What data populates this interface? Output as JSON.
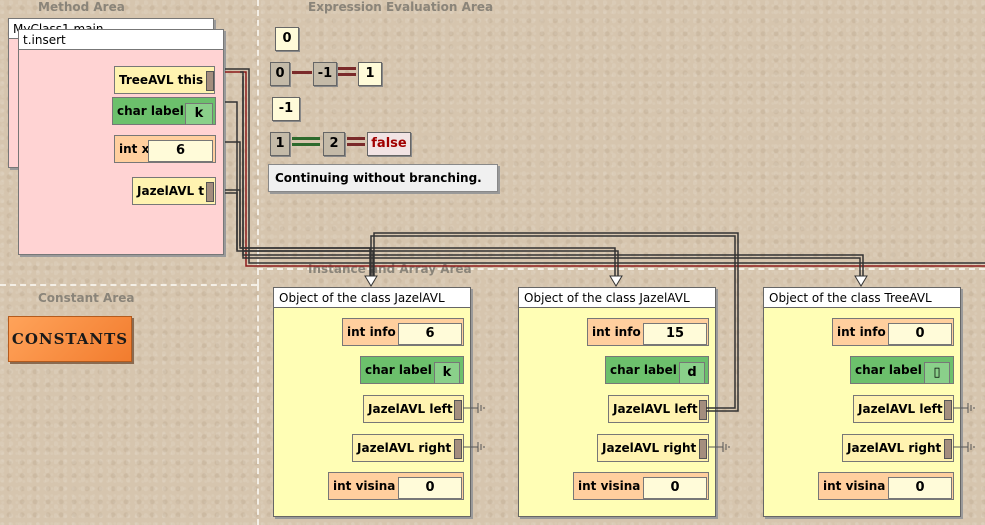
{
  "areas": {
    "method": "Method Area",
    "expression": "Expression Evaluation Area",
    "instance": "Instance and Array Area",
    "constant": "Constant Area"
  },
  "method_area": {
    "back_frame_title": "MyClass1.main",
    "frame_title": "t.insert",
    "vars": [
      {
        "type": "TreeAVL this",
        "value": ""
      },
      {
        "type": "char label",
        "value": "k"
      },
      {
        "type": "int x",
        "value": "6"
      },
      {
        "type": "JazelAVL t",
        "value": ""
      }
    ]
  },
  "expression_area": {
    "row1": "0",
    "row2": {
      "left": "0",
      "mid": "-1",
      "right": "1"
    },
    "row3": "-1",
    "row4": {
      "left": "1",
      "mid": "2",
      "result": "false"
    },
    "message": "Continuing without branching."
  },
  "constants_button": "CONSTANTS",
  "objects": [
    {
      "title": "Object of the class JazelAVL",
      "fields": [
        {
          "type": "int info",
          "value": "6"
        },
        {
          "type": "char label",
          "value": "k"
        },
        {
          "type": "JazelAVL left",
          "value": ""
        },
        {
          "type": "JazelAVL right",
          "value": ""
        },
        {
          "type": "int visina",
          "value": "0"
        }
      ]
    },
    {
      "title": "Object of the class JazelAVL",
      "fields": [
        {
          "type": "int info",
          "value": "15"
        },
        {
          "type": "char label",
          "value": "d"
        },
        {
          "type": "JazelAVL left",
          "value": ""
        },
        {
          "type": "JazelAVL right",
          "value": ""
        },
        {
          "type": "int visina",
          "value": "0"
        }
      ]
    },
    {
      "title": "Object of the class TreeAVL",
      "fields": [
        {
          "type": "int info",
          "value": "0"
        },
        {
          "type": "char label",
          "value": "▯"
        },
        {
          "type": "JazelAVL left",
          "value": ""
        },
        {
          "type": "JazelAVL right",
          "value": ""
        },
        {
          "type": "int visina",
          "value": "0"
        }
      ]
    }
  ],
  "colors": {
    "background": "#d6c5ae",
    "frame": "#ffd3d3",
    "object": "#fffeb5",
    "var_yellow": "#fff3b0",
    "var_green": "#6cc06c",
    "var_orange": "#ffcf9e",
    "false_text": "#a10000",
    "wire_red": "#8b1a1a"
  }
}
